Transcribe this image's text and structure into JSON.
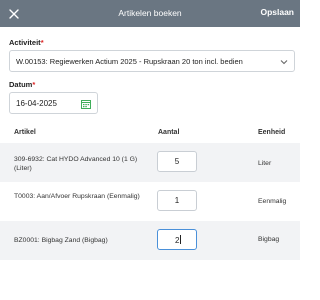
{
  "header": {
    "title": "Artikelen boeken",
    "save_label": "Opslaan"
  },
  "activiteit": {
    "label": "Activiteit",
    "required_mark": "*",
    "value": "W.00153: Regiewerken Actium 2025 - Rupskraan 20 ton incl. bedien"
  },
  "datum": {
    "label": "Datum",
    "required_mark": "*",
    "value": "16-04-2025"
  },
  "table": {
    "headers": {
      "artikel": "Artikel",
      "aantal": "Aantal",
      "eenheid": "Eenheid"
    },
    "rows": [
      {
        "artikel": "309-6932: Cat HYDO Advanced 10 (1 G) (Liter)",
        "aantal": "5",
        "eenheid": "Liter"
      },
      {
        "artikel": "T0003: Aan/Afvoer Rupskraan (Eenmalig)",
        "aantal": "1",
        "eenheid": "Eenmalig"
      },
      {
        "artikel": "BZ0001: Bigbag Zand (Bigbag)",
        "aantal": "2",
        "eenheid": "Bigbag"
      }
    ]
  },
  "colors": {
    "header_bg": "#6a7682",
    "required": "#d22222",
    "calendar_icon": "#3fae5a",
    "focus_border": "#4a90d9"
  },
  "icons": {
    "back": "close-icon",
    "dropdown": "chevron-down-icon",
    "calendar": "calendar-icon"
  }
}
